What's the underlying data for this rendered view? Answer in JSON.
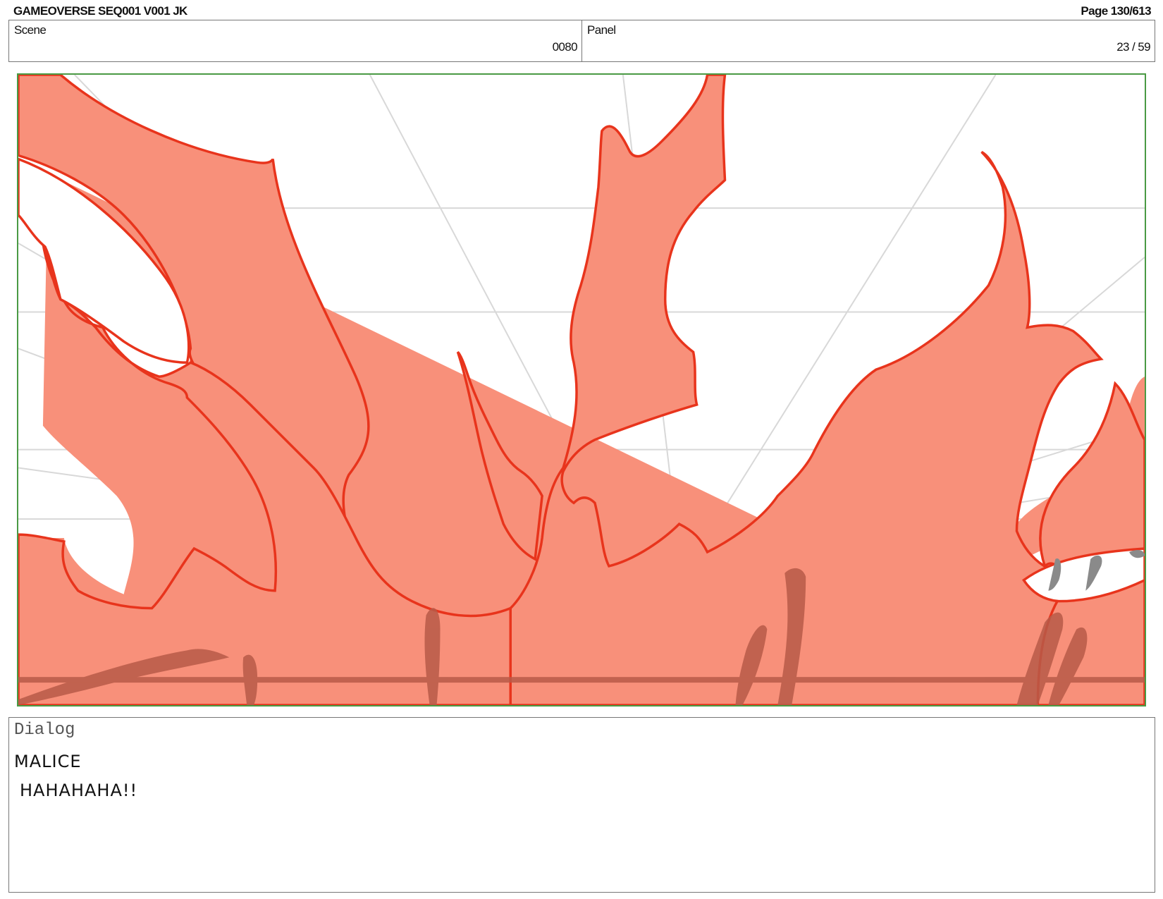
{
  "header": {
    "title": "GAMEOVERSE SEQ001 V001 JK",
    "page": "Page 130/613"
  },
  "info": {
    "scene_label": "Scene",
    "scene_value": "0080",
    "panel_label": "Panel",
    "panel_value": "23 / 59"
  },
  "artwork": {
    "description_icon": "storyboard-flame-sketch",
    "fill_color": "#f8907a",
    "stroke_color": "#e8341c",
    "shadow_color": "#b85a48",
    "frame_color": "#4a9a44"
  },
  "dialog": {
    "label": "Dialog",
    "speaker": "MALICE",
    "line": "HAHAHAHA!!"
  }
}
